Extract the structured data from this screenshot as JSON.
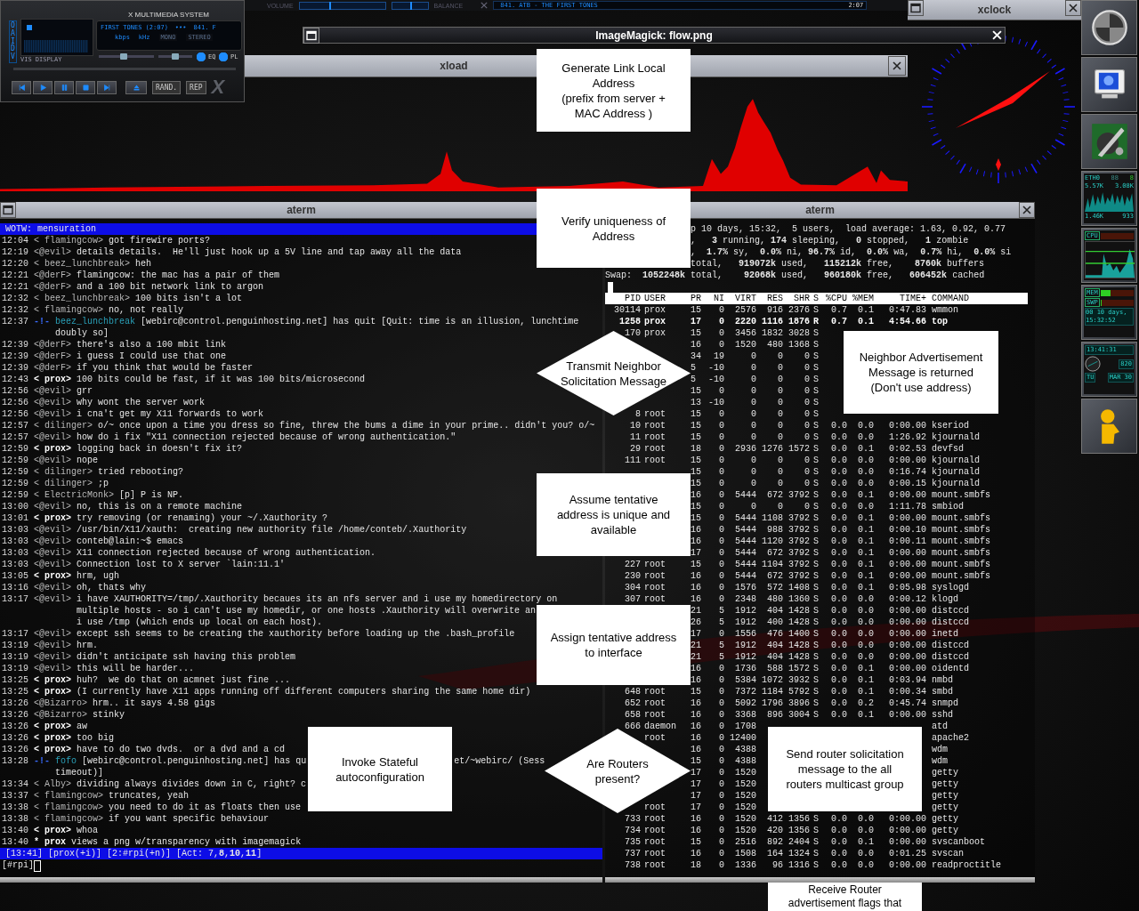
{
  "player": {
    "title": "X MULTIMEDIA SYSTEM",
    "side_label": "OAIDV",
    "vis_label": "VIS DISPLAY",
    "track": "FIRST TONES (2:07)",
    "dots": "•••",
    "scroll": "841. F",
    "kbps": "kbps",
    "khz": "kHz",
    "mono": {
      "label": "MONO",
      "on": false
    },
    "stereo": {
      "label": "STEREO",
      "on": false
    },
    "volume": {
      "level": 0.45
    },
    "balance": {
      "level": 0.5
    },
    "eq": {
      "label": "EQ",
      "on": true
    },
    "pl": {
      "label": "PL",
      "on": true
    },
    "controls": [
      {
        "kind": "previous"
      },
      {
        "kind": "play"
      },
      {
        "kind": "pause"
      },
      {
        "kind": "stop"
      },
      {
        "kind": "next"
      }
    ],
    "eject": {
      "kind": "eject"
    },
    "rand": {
      "label": "RAND.",
      "on": false
    },
    "rep": {
      "label": "REP",
      "on": false
    },
    "logo": "X"
  },
  "shade": {
    "volume_label": "VOLUME",
    "volume": {
      "level": 0.35
    },
    "balance_label": "BALANCE",
    "balance": {
      "level": 0.5
    },
    "title": "841. ATB - THE FIRST TONES",
    "time": "2:07"
  },
  "xload": {
    "title": "xload"
  },
  "imagemagick": {
    "title": "ImageMagick: flow.png",
    "nodes": [
      {
        "kind": "process",
        "lines": [
          "Generate Link Local",
          "Address",
          "(prefix from server +",
          "MAC Address )"
        ]
      },
      {
        "kind": "process",
        "lines": [
          "Verify uniqueness of",
          "Address"
        ]
      },
      {
        "kind": "decision",
        "lines": [
          "Transmit Neighbor",
          "Solicitation Message"
        ]
      },
      {
        "kind": "process",
        "lines": [
          "Neighbor Advertisement",
          "Message is returned",
          "(Don't use address)"
        ]
      },
      {
        "kind": "process",
        "lines": [
          "Assume tentative",
          "address is unique and",
          "available"
        ]
      },
      {
        "kind": "process",
        "lines": [
          "Assign tentative address",
          "to interface"
        ]
      },
      {
        "kind": "process",
        "lines": [
          "Invoke Stateful",
          "autoconfiguration"
        ]
      },
      {
        "kind": "decision",
        "lines": [
          "Are  Routers",
          "present?"
        ]
      },
      {
        "kind": "process",
        "lines": [
          "Send router solicitation",
          "message to the all",
          "routers multicast group"
        ]
      },
      {
        "kind": "process",
        "lines": [
          "Receive Router",
          "advertisement flags that"
        ]
      }
    ]
  },
  "xclock": {
    "title": "xclock"
  },
  "irc": {
    "title": "aterm",
    "topic": "WOTW: mensuration",
    "lines": [
      {
        "time": "12:04",
        "kind": "msg",
        "nick": "< flamingcow>",
        "own": false,
        "text": "got firewire ports?"
      },
      {
        "time": "12:19",
        "kind": "msg",
        "nick": "<@evil>",
        "own": false,
        "text": "details details.  He'll just hook up a 5V line and tap away all the data"
      },
      {
        "time": "12:20",
        "kind": "msg",
        "nick": "< beez_lunchbreak>",
        "own": false,
        "text": "heh"
      },
      {
        "time": "12:21",
        "kind": "msg",
        "nick": "<@derF>",
        "own": false,
        "text": "flamingcow: the mac has a pair of them"
      },
      {
        "time": "12:21",
        "kind": "msg",
        "nick": "<@derF>",
        "own": false,
        "text": "and a 100 bit network link to argon"
      },
      {
        "time": "12:32",
        "kind": "msg",
        "nick": "< beez_lunchbreak>",
        "own": false,
        "text": "100 bits isn't a lot"
      },
      {
        "time": "12:32",
        "kind": "msg",
        "nick": "< flamingcow>",
        "own": false,
        "text": "no, not really"
      },
      {
        "time": "12:37",
        "kind": "event",
        "marker": "-!-",
        "nick": "beez_lunchbreak",
        "own": false,
        "text": "[webirc@control.penguinhosting.net] has quit [Quit: time is an illusion, lunchtime",
        "wrap": [
          "doubly so]"
        ]
      },
      {
        "time": "12:39",
        "kind": "msg",
        "nick": "<@derF>",
        "own": false,
        "text": "there's also a 100 mbit link"
      },
      {
        "time": "12:39",
        "kind": "msg",
        "nick": "<@derF>",
        "own": false,
        "text": "i guess I could use that one"
      },
      {
        "time": "12:39",
        "kind": "msg",
        "nick": "<@derF>",
        "own": false,
        "text": "if you think that would be faster"
      },
      {
        "time": "12:43",
        "kind": "msg",
        "nick": "< prox>",
        "own": true,
        "text": "100 bits could be fast, if it was 100 bits/microsecond"
      },
      {
        "time": "12:56",
        "kind": "msg",
        "nick": "<@evil>",
        "own": false,
        "text": "grr"
      },
      {
        "time": "12:56",
        "kind": "msg",
        "nick": "<@evil>",
        "own": false,
        "text": "why wont the server work"
      },
      {
        "time": "12:56",
        "kind": "msg",
        "nick": "<@evil>",
        "own": false,
        "text": "i cna't get my X11 forwards to work"
      },
      {
        "time": "12:57",
        "kind": "msg",
        "nick": "< dilinger>",
        "own": false,
        "text": "o/~ once upon a time you dress so fine, threw the bums a dime in your prime.. didn't you? o/~"
      },
      {
        "time": "12:57",
        "kind": "msg",
        "nick": "<@evil>",
        "own": false,
        "text": "how do i fix \"X11 connection rejected because of wrong authentication.\""
      },
      {
        "time": "12:59",
        "kind": "msg",
        "nick": "< prox>",
        "own": true,
        "text": "logging back in doesn't fix it?"
      },
      {
        "time": "12:59",
        "kind": "msg",
        "nick": "<@evil>",
        "own": false,
        "text": "nope"
      },
      {
        "time": "12:59",
        "kind": "msg",
        "nick": "< dilinger>",
        "own": false,
        "text": "tried rebooting?"
      },
      {
        "time": "12:59",
        "kind": "msg",
        "nick": "< dilinger>",
        "own": false,
        "text": ";p"
      },
      {
        "time": "12:59",
        "kind": "msg",
        "nick": "< ElectricMonk>",
        "own": false,
        "text": "[p] P is NP."
      },
      {
        "time": "13:00",
        "kind": "msg",
        "nick": "<@evil>",
        "own": false,
        "text": "no, this is on a remote machine"
      },
      {
        "time": "13:01",
        "kind": "msg",
        "nick": "< prox>",
        "own": true,
        "text": "try removing (or renaming) your ~/.Xauthority ?"
      },
      {
        "time": "13:03",
        "kind": "msg",
        "nick": "<@evil>",
        "own": false,
        "text": "/usr/bin/X11/xauth:  creating new authority file /home/conteb/.Xauthority"
      },
      {
        "time": "13:03",
        "kind": "msg",
        "nick": "<@evil>",
        "own": false,
        "text": "conteb@lain:~$ emacs"
      },
      {
        "time": "13:03",
        "kind": "msg",
        "nick": "<@evil>",
        "own": false,
        "text": "X11 connection rejected because of wrong authentication."
      },
      {
        "time": "13:03",
        "kind": "msg",
        "nick": "<@evil>",
        "own": false,
        "text": "Connection lost to X server `lain:11.1'"
      },
      {
        "time": "13:05",
        "kind": "msg",
        "nick": "< prox>",
        "own": true,
        "text": "hrm, ugh"
      },
      {
        "time": "13:16",
        "kind": "msg",
        "nick": "<@evil>",
        "own": false,
        "text": "oh, thats why"
      },
      {
        "time": "13:17",
        "kind": "msg",
        "nick": "<@evil>",
        "own": false,
        "text": "i have XAUTHORITY=/tmp/.Xauthority becaues its an nfs server and i use my homedirectory on",
        "wrap": [
          "multiple hosts - so i can't use my homedir, or one hosts .Xauthority will overwrite an",
          "i use /tmp (which ends up local on each host)."
        ]
      },
      {
        "time": "13:17",
        "kind": "msg",
        "nick": "<@evil>",
        "own": false,
        "text": "except ssh seems to be creating the xauthority before loading up the .bash_profile"
      },
      {
        "time": "13:19",
        "kind": "msg",
        "nick": "<@evil>",
        "own": false,
        "text": "hrm."
      },
      {
        "time": "13:19",
        "kind": "msg",
        "nick": "<@evil>",
        "own": false,
        "text": "didn't anticipate ssh having this problem"
      },
      {
        "time": "13:19",
        "kind": "msg",
        "nick": "<@evil>",
        "own": false,
        "text": "this will be harder..."
      },
      {
        "time": "13:25",
        "kind": "msg",
        "nick": "< prox>",
        "own": true,
        "text": "huh?  we do that on acmnet just fine ..."
      },
      {
        "time": "13:25",
        "kind": "msg",
        "nick": "< prox>",
        "own": true,
        "text": "(I currently have X11 apps running off different computers sharing the same home dir)"
      },
      {
        "time": "13:26",
        "kind": "msg",
        "nick": "<@Bizarro>",
        "own": false,
        "text": "hrm.. it says 4.58 gigs"
      },
      {
        "time": "13:26",
        "kind": "msg",
        "nick": "<@Bizarro>",
        "own": false,
        "text": "stinky"
      },
      {
        "time": "13:26",
        "kind": "msg",
        "nick": "< prox>",
        "own": true,
        "text": "aw"
      },
      {
        "time": "13:26",
        "kind": "msg",
        "nick": "< prox>",
        "own": true,
        "text": "too big"
      },
      {
        "time": "13:26",
        "kind": "msg",
        "nick": "< prox>",
        "own": true,
        "text": "have to do two dvds.  or a dvd and a cd"
      },
      {
        "time": "13:28",
        "kind": "event",
        "marker": "-!-",
        "nick": "fofo",
        "own": false,
        "text": "[webirc@control.penguinhosting.net] has qu",
        "tail": "et/~webirc/ (Sess",
        "wrap": [
          "timeout)]"
        ]
      },
      {
        "time": "13:34",
        "kind": "msg",
        "nick": "< Alby>",
        "own": false,
        "text": "dividing always divides down in C, right? c"
      },
      {
        "time": "13:37",
        "kind": "msg",
        "nick": "< flamingcow>",
        "own": false,
        "text": "truncates, yeah"
      },
      {
        "time": "13:38",
        "kind": "msg",
        "nick": "< flamingcow>",
        "own": false,
        "text": "you need to do it as floats then use"
      },
      {
        "time": "13:38",
        "kind": "msg",
        "nick": "< flamingcow>",
        "own": false,
        "text": "if you want specific behaviour"
      },
      {
        "time": "13:40",
        "kind": "msg",
        "nick": "< prox>",
        "own": true,
        "text": "whoa"
      },
      {
        "time": "13:40",
        "kind": "action",
        "marker": "*",
        "nick": "prox",
        "own": true,
        "text": "views a png w/transparency with imagemagick"
      }
    ],
    "status": "[13:41] [prox(+i)] [2:#rpi(+n)] [Act: 7,**8**,**10**,**11**]",
    "prompt": "[#rpi]"
  },
  "top": {
    "title": "aterm",
    "summary": [
      {
        "text": "p 10 days, 15:32,  5 users,  load average: 1.63, 0.92, 0.77",
        "clipped": true
      },
      {
        "text": ",   **3** running, **174** sleeping,   **0** stopped,   **1** zombie",
        "clipped": true
      },
      {
        "text": ",  **1.7%** sy,  **0.0%** ni, **96.7%** id,  **0.0%** wa,  **0.7%** hi,  **0.0%** si",
        "clipped": true
      },
      {
        "text": "total,   **919072k** used,   **115212k** free,    **8760k** buffers",
        "clipped": true
      },
      {
        "text": "Swap:  **1052248k** total,    **92068k** used,   **960180k** free,   **606452k** cached",
        "clipped": false
      }
    ],
    "columns": [
      "PID",
      "USER",
      "PR",
      "NI",
      "VIRT",
      "RES",
      "SHR",
      "S",
      "%CPU",
      "%MEM",
      "TIME+",
      "COMMAND"
    ],
    "rows": [
      {
        "bold": false,
        "cells": [
          "30114",
          "prox",
          "15",
          "0",
          "2576",
          "916",
          "2376",
          "S",
          "0.7",
          "0.1",
          "0:47.83",
          "wmmon"
        ]
      },
      {
        "bold": true,
        "cells": [
          "1258",
          "prox",
          "17",
          "0",
          "2220",
          "1116",
          "1876",
          "R",
          "0.7",
          "0.1",
          "4:54.66",
          "top"
        ]
      },
      {
        "bold": false,
        "cells": [
          "170",
          "prox",
          "15",
          "0",
          "3456",
          "1832",
          "3028",
          "S",
          null,
          null,
          null,
          null
        ]
      },
      {
        "bold": false,
        "cells": [
          null,
          null,
          "16",
          "0",
          "1520",
          "480",
          "1368",
          "S",
          null,
          null,
          null,
          null
        ]
      },
      {
        "bold": false,
        "cells": [
          null,
          null,
          "34",
          "19",
          "0",
          "0",
          "0",
          "S",
          null,
          null,
          null,
          null
        ]
      },
      {
        "bold": false,
        "cells": [
          null,
          null,
          "5",
          "-10",
          "0",
          "0",
          "0",
          "S",
          null,
          null,
          null,
          null
        ]
      },
      {
        "bold": false,
        "cells": [
          null,
          null,
          "5",
          "-10",
          "0",
          "0",
          "0",
          "S",
          null,
          null,
          null,
          null
        ]
      },
      {
        "bold": false,
        "cells": [
          null,
          null,
          "15",
          "0",
          "0",
          "0",
          "0",
          "S",
          null,
          null,
          null,
          null
        ]
      },
      {
        "bold": false,
        "cells": [
          null,
          null,
          "13",
          "-10",
          "0",
          "0",
          "0",
          "S",
          null,
          null,
          null,
          null
        ]
      },
      {
        "bold": false,
        "cells": [
          "8",
          "root",
          "15",
          "0",
          "0",
          "0",
          "0",
          "S",
          null,
          null,
          null,
          null
        ]
      },
      {
        "bold": false,
        "cells": [
          "10",
          "root",
          "15",
          "0",
          "0",
          "0",
          "0",
          "S",
          "0.0",
          "0.0",
          "0:00.00",
          "kseriod"
        ]
      },
      {
        "bold": false,
        "cells": [
          "11",
          "root",
          "15",
          "0",
          "0",
          "0",
          "0",
          "S",
          "0.0",
          "0.0",
          "1:26.92",
          "kjournald"
        ]
      },
      {
        "bold": false,
        "cells": [
          "29",
          "root",
          "18",
          "0",
          "2936",
          "1276",
          "1572",
          "S",
          "0.0",
          "0.1",
          "0:02.53",
          "devfsd"
        ]
      },
      {
        "bold": false,
        "cells": [
          "111",
          "root",
          "15",
          "0",
          "0",
          "0",
          "0",
          "S",
          "0.0",
          "0.0",
          "0:00.00",
          "kjournald"
        ]
      },
      {
        "bold": false,
        "cells": [
          null,
          null,
          "15",
          "0",
          "0",
          "0",
          "0",
          "S",
          "0.0",
          "0.0",
          "0:16.74",
          "kjournald"
        ]
      },
      {
        "bold": false,
        "cells": [
          null,
          null,
          "15",
          "0",
          "0",
          "0",
          "0",
          "S",
          "0.0",
          "0.0",
          "0:00.15",
          "kjournald"
        ]
      },
      {
        "bold": false,
        "cells": [
          null,
          null,
          "16",
          "0",
          "5444",
          "672",
          "3792",
          "S",
          "0.0",
          "0.1",
          "0:00.00",
          "mount.smbfs"
        ]
      },
      {
        "bold": false,
        "cells": [
          null,
          null,
          "15",
          "0",
          "0",
          "0",
          "0",
          "S",
          "0.0",
          "0.0",
          "1:11.78",
          "smbiod"
        ]
      },
      {
        "bold": false,
        "cells": [
          null,
          null,
          "15",
          "0",
          "5444",
          "1108",
          "3792",
          "S",
          "0.0",
          "0.1",
          "0:00.00",
          "mount.smbfs"
        ]
      },
      {
        "bold": false,
        "cells": [
          null,
          null,
          "16",
          "0",
          "5444",
          "988",
          "3792",
          "S",
          "0.0",
          "0.1",
          "0:00.10",
          "mount.smbfs"
        ]
      },
      {
        "bold": false,
        "cells": [
          null,
          null,
          "16",
          "0",
          "5444",
          "1120",
          "3792",
          "S",
          "0.0",
          "0.1",
          "0:00.11",
          "mount.smbfs"
        ]
      },
      {
        "bold": false,
        "cells": [
          null,
          null,
          "17",
          "0",
          "5444",
          "672",
          "3792",
          "S",
          "0.0",
          "0.1",
          "0:00.00",
          "mount.smbfs"
        ]
      },
      {
        "bold": false,
        "cells": [
          "227",
          "root",
          "15",
          "0",
          "5444",
          "1104",
          "3792",
          "S",
          "0.0",
          "0.1",
          "0:00.00",
          "mount.smbfs"
        ]
      },
      {
        "bold": false,
        "cells": [
          "230",
          "root",
          "16",
          "0",
          "5444",
          "672",
          "3792",
          "S",
          "0.0",
          "0.1",
          "0:00.00",
          "mount.smbfs"
        ]
      },
      {
        "bold": false,
        "cells": [
          "304",
          "root",
          "16",
          "0",
          "1576",
          "572",
          "1408",
          "S",
          "0.0",
          "0.1",
          "0:05.98",
          "syslogd"
        ]
      },
      {
        "bold": false,
        "cells": [
          "307",
          "root",
          "16",
          "0",
          "2348",
          "480",
          "1360",
          "S",
          "0.0",
          "0.0",
          "0:00.12",
          "klogd"
        ]
      },
      {
        "bold": false,
        "cells": [
          null,
          null,
          "21",
          "5",
          "1912",
          "404",
          "1428",
          "S",
          "0.0",
          "0.0",
          "0:00.00",
          "distccd"
        ]
      },
      {
        "bold": false,
        "cells": [
          null,
          null,
          "26",
          "5",
          "1912",
          "400",
          "1428",
          "S",
          "0.0",
          "0.0",
          "0:00.00",
          "distccd"
        ]
      },
      {
        "bold": false,
        "cells": [
          null,
          null,
          "17",
          "0",
          "1556",
          "476",
          "1400",
          "S",
          "0.0",
          "0.0",
          "0:00.00",
          "inetd"
        ]
      },
      {
        "bold": false,
        "cells": [
          null,
          null,
          "21",
          "5",
          "1912",
          "404",
          "1428",
          "S",
          "0.0",
          "0.0",
          "0:00.00",
          "distccd"
        ]
      },
      {
        "bold": false,
        "cells": [
          null,
          null,
          "21",
          "5",
          "1912",
          "404",
          "1428",
          "S",
          "0.0",
          "0.0",
          "0:00.00",
          "distccd"
        ]
      },
      {
        "bold": false,
        "cells": [
          null,
          null,
          "16",
          "0",
          "1736",
          "588",
          "1572",
          "S",
          "0.0",
          "0.1",
          "0:00.00",
          "oidentd"
        ]
      },
      {
        "bold": false,
        "cells": [
          null,
          null,
          "16",
          "0",
          "5384",
          "1072",
          "3932",
          "S",
          "0.0",
          "0.1",
          "0:03.94",
          "nmbd"
        ]
      },
      {
        "bold": false,
        "cells": [
          "648",
          "root",
          "15",
          "0",
          "7372",
          "1184",
          "5792",
          "S",
          "0.0",
          "0.1",
          "0:00.34",
          "smbd"
        ]
      },
      {
        "bold": false,
        "cells": [
          "652",
          "root",
          "16",
          "0",
          "5092",
          "1796",
          "3896",
          "S",
          "0.0",
          "0.2",
          "0:45.74",
          "snmpd"
        ]
      },
      {
        "bold": false,
        "cells": [
          "658",
          "root",
          "16",
          "0",
          "3368",
          "896",
          "3004",
          "S",
          "0.0",
          "0.1",
          "0:00.00",
          "sshd"
        ]
      },
      {
        "bold": false,
        "cells": [
          "666",
          "daemon",
          "16",
          "0",
          "1708",
          null,
          null,
          null,
          null,
          null,
          null,
          "atd"
        ]
      },
      {
        "bold": false,
        "cells": [
          null,
          "root",
          "16",
          "0",
          "12400",
          null,
          null,
          null,
          null,
          null,
          null,
          "apache2"
        ]
      },
      {
        "bold": false,
        "cells": [
          null,
          null,
          "16",
          "0",
          "4388",
          null,
          null,
          null,
          null,
          null,
          null,
          "wdm"
        ]
      },
      {
        "bold": false,
        "cells": [
          null,
          null,
          "15",
          "0",
          "4388",
          null,
          null,
          null,
          null,
          null,
          null,
          "wdm"
        ]
      },
      {
        "bold": false,
        "cells": [
          null,
          null,
          "17",
          "0",
          "1520",
          null,
          null,
          null,
          null,
          null,
          null,
          "getty"
        ]
      },
      {
        "bold": false,
        "cells": [
          null,
          null,
          "17",
          "0",
          "1520",
          null,
          null,
          null,
          null,
          null,
          null,
          "getty"
        ]
      },
      {
        "bold": false,
        "cells": [
          null,
          null,
          "17",
          "0",
          "1520",
          null,
          null,
          null,
          null,
          null,
          null,
          "getty"
        ]
      },
      {
        "bold": false,
        "cells": [
          null,
          "root",
          "17",
          "0",
          "1520",
          null,
          null,
          null,
          null,
          null,
          null,
          "getty"
        ]
      },
      {
        "bold": false,
        "cells": [
          "733",
          "root",
          "16",
          "0",
          "1520",
          "412",
          "1356",
          "S",
          "0.0",
          "0.0",
          "0:00.00",
          "getty"
        ]
      },
      {
        "bold": false,
        "cells": [
          "734",
          "root",
          "16",
          "0",
          "1520",
          "420",
          "1356",
          "S",
          "0.0",
          "0.0",
          "0:00.00",
          "getty"
        ]
      },
      {
        "bold": false,
        "cells": [
          "735",
          "root",
          "15",
          "0",
          "2516",
          "892",
          "2404",
          "S",
          "0.0",
          "0.1",
          "0:00.00",
          "svscanboot"
        ]
      },
      {
        "bold": false,
        "cells": [
          "737",
          "root",
          "16",
          "0",
          "1508",
          "164",
          "1324",
          "S",
          "0.0",
          "0.0",
          "0:01.25",
          "svscan"
        ]
      },
      {
        "bold": false,
        "cells": [
          "738",
          "root",
          "18",
          "0",
          "1336",
          "96",
          "1316",
          "S",
          "0.0",
          "0.0",
          "0:00.00",
          "readproctitle"
        ]
      }
    ]
  },
  "dock": [
    {
      "kind": "logo"
    },
    {
      "kind": "monitor"
    },
    {
      "kind": "paint"
    },
    {
      "kind": "net",
      "label": "ETH0",
      "digits": "88",
      "units": "8",
      "rx": "5.57K",
      "tx": "3.08K",
      "low_rx": "1.46K",
      "low_tx": "933"
    },
    {
      "kind": "cpu",
      "label": "CPU"
    },
    {
      "kind": "mem",
      "meters": [
        {
          "label": "MEM",
          "level": 0.3
        },
        {
          "label": "SWP",
          "level": 0.03
        }
      ],
      "days": "00 10 days,",
      "uptime": "15:32:52"
    },
    {
      "kind": "clock",
      "time": "13:41:31",
      "readout": "820",
      "day": "TU",
      "date": "MAR 30"
    },
    {
      "kind": "figure"
    }
  ]
}
